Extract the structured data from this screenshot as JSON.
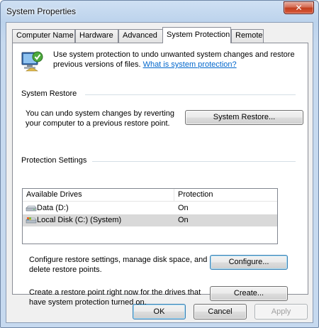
{
  "window": {
    "title": "System Properties",
    "close_glyph": "✕"
  },
  "tabs": [
    {
      "label": "Computer Name",
      "active": false
    },
    {
      "label": "Hardware",
      "active": false
    },
    {
      "label": "Advanced",
      "active": false
    },
    {
      "label": "System Protection",
      "active": true
    },
    {
      "label": "Remote",
      "active": false
    }
  ],
  "intro": {
    "text": "Use system protection to undo unwanted system changes and restore previous versions of files.",
    "link": "What is system protection?",
    "icon": "system-protection-icon"
  },
  "system_restore": {
    "heading": "System Restore",
    "description": "You can undo system changes by reverting your computer to a previous restore point.",
    "button": "System Restore..."
  },
  "protection_settings": {
    "heading": "Protection Settings",
    "columns": [
      "Available Drives",
      "Protection"
    ],
    "rows": [
      {
        "drive": "Data (D:)",
        "protection": "On",
        "icon": "drive-icon",
        "selected": false
      },
      {
        "drive": "Local Disk (C:) (System)",
        "protection": "On",
        "icon": "system-drive-icon",
        "selected": true
      }
    ]
  },
  "configure": {
    "description": "Configure restore settings, manage disk space, and delete restore points.",
    "button": "Configure..."
  },
  "create": {
    "description": "Create a restore point right now for the drives that have system protection turned on.",
    "button": "Create..."
  },
  "footer": {
    "ok": "OK",
    "cancel": "Cancel",
    "apply": "Apply"
  },
  "colors": {
    "link": "#0066cc",
    "close_button": "#c2401f",
    "selection": "#d9d9d9"
  }
}
